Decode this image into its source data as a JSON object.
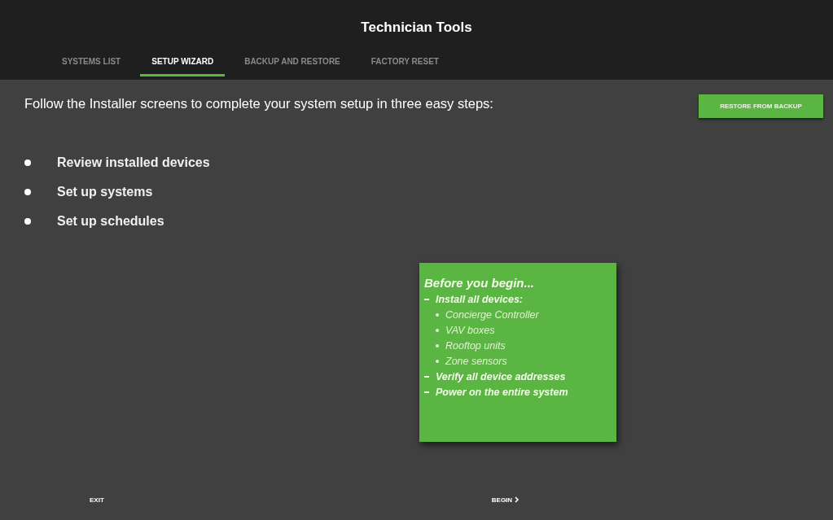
{
  "window": {
    "title": "Technician Tools"
  },
  "tabs": [
    {
      "label": "SYSTEMS LIST",
      "selected": false
    },
    {
      "label": "SETUP WIZARD",
      "selected": true
    },
    {
      "label": "BACKUP AND RESTORE",
      "selected": false
    },
    {
      "label": "FACTORY RESET",
      "selected": false
    }
  ],
  "instruction": "Follow the Installer screens to complete your system setup in three easy steps:",
  "restore_button": "RESTORE FROM BACKUP",
  "steps": [
    "Review installed devices",
    "Set up systems",
    "Set up schedules"
  ],
  "checklist": {
    "heading": "Before you begin...",
    "items": [
      {
        "label": "Install all devices:",
        "children": [
          {
            "label": "Concierge Controller"
          },
          {
            "label": "VAV boxes"
          },
          {
            "label": "Rooftop units"
          },
          {
            "label": "Zone sensors"
          }
        ]
      },
      {
        "label": "Verify all device addresses"
      },
      {
        "label": "Power on the entire system"
      }
    ]
  },
  "footer": {
    "exit": "EXIT",
    "begin": "BEGIN"
  }
}
